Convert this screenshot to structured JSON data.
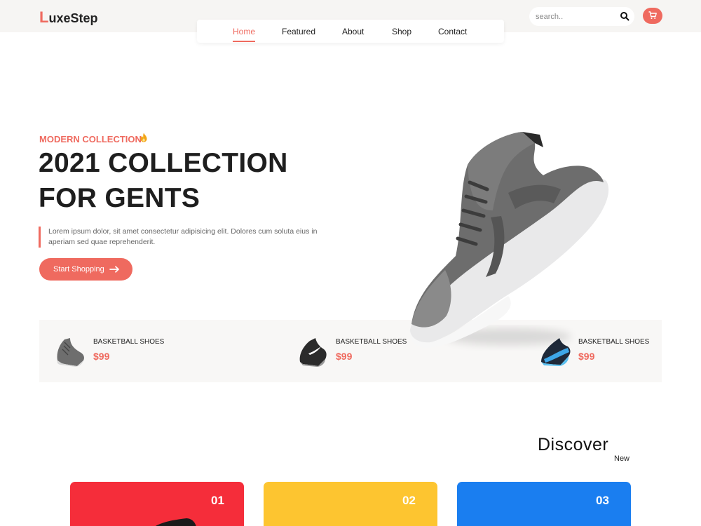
{
  "brand": {
    "first_letter": "L",
    "rest": "uxeStep"
  },
  "nav": {
    "items": [
      {
        "label": "Home",
        "active": true
      },
      {
        "label": "Featured",
        "active": false
      },
      {
        "label": "About",
        "active": false
      },
      {
        "label": "Shop",
        "active": false
      },
      {
        "label": "Contact",
        "active": false
      }
    ]
  },
  "search": {
    "placeholder": "search..",
    "value": "",
    "icon": "search-icon"
  },
  "cart": {
    "icon": "cart-icon"
  },
  "hero": {
    "kicker": "MODERN COLLECTION",
    "kicker_icon": "flame-icon",
    "title_line1": "2021 COLLECTION",
    "title_line2": "FOR GENTS",
    "description": "Lorem ipsum dolor, sit amet consectetur adipisicing elit. Dolores cum soluta eius in aperiam sed quae reprehenderit.",
    "cta_label": "Start Shopping",
    "cta_icon": "arrow-right-icon"
  },
  "featured": [
    {
      "name": "BASKETBALL SHOES",
      "price": "$99",
      "color": "#6e6e6e"
    },
    {
      "name": "BASKETBALL SHOES",
      "price": "$99",
      "color": "#2b2b2b"
    },
    {
      "name": "BASKETBALL SHOES",
      "price": "$99",
      "color": "#1f2a3a"
    }
  ],
  "discover": {
    "title": "Discover",
    "subtitle": "New"
  },
  "cards": [
    {
      "number": "01",
      "color": "#f52d3a"
    },
    {
      "number": "02",
      "color": "#fdc530"
    },
    {
      "number": "03",
      "color": "#1a7ef0"
    }
  ],
  "colors": {
    "accent": "#ef6a5f",
    "text": "#1e1e1e",
    "header_bg": "#f6f5f3"
  }
}
